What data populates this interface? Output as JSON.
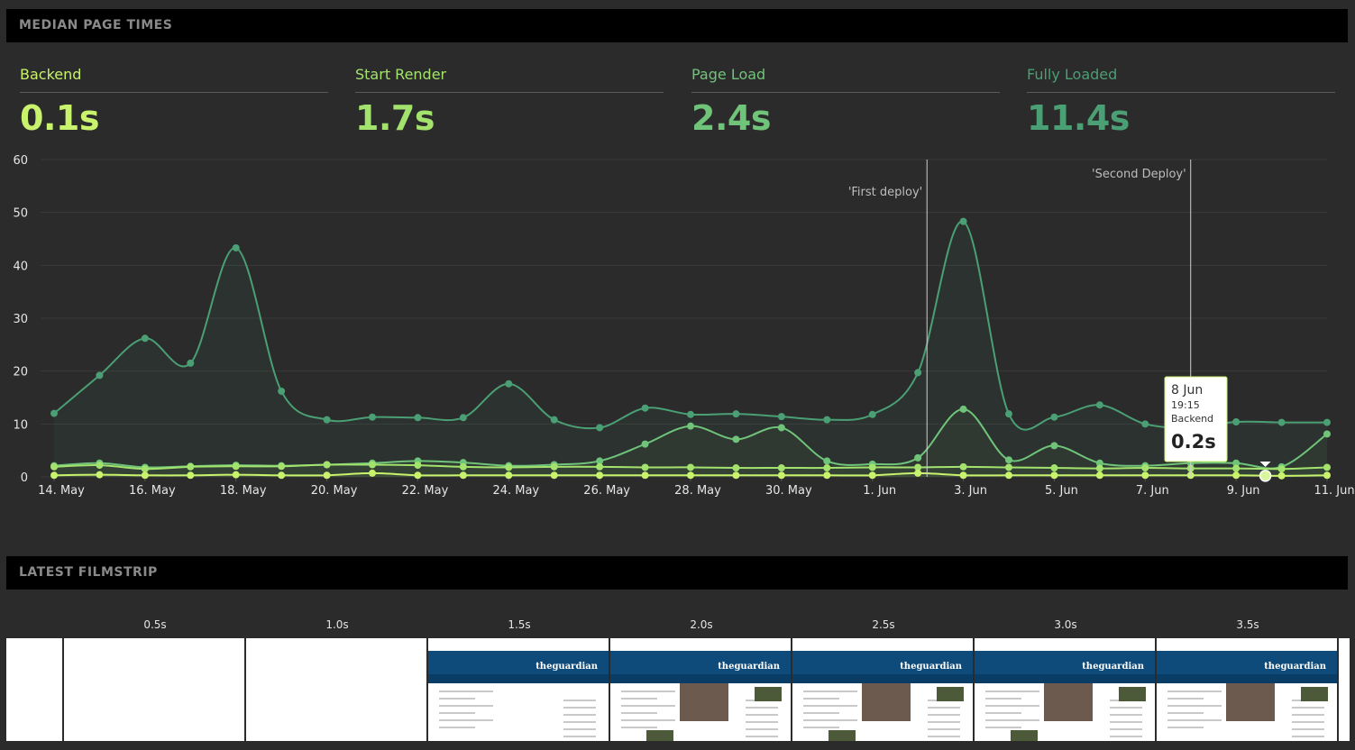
{
  "sections": {
    "median_title": "MEDIAN PAGE TIMES",
    "filmstrip_title": "LATEST FILMSTRIP"
  },
  "metrics": [
    {
      "label": "Backend",
      "value": "0.1s",
      "color": "#c9f26d"
    },
    {
      "label": "Start Render",
      "value": "1.7s",
      "color": "#a3e36d"
    },
    {
      "label": "Page Load",
      "value": "2.4s",
      "color": "#6fc47a"
    },
    {
      "label": "Fully Loaded",
      "value": "11.4s",
      "color": "#4a9f74"
    }
  ],
  "tooltip": {
    "date": "8 Jun",
    "time": "19:15",
    "series": "Backend",
    "value": "0.2s"
  },
  "filmstrip": {
    "times": [
      "0.5s",
      "1.0s",
      "1.5s",
      "2.0s",
      "2.5s",
      "3.0s",
      "3.5s"
    ],
    "logo_text": "theguardian"
  },
  "chart_data": {
    "type": "line",
    "ylim": [
      0,
      60
    ],
    "y_ticks": [
      0,
      10,
      20,
      30,
      40,
      50,
      60
    ],
    "x_tick_labels": [
      "14. May",
      "16. May",
      "18. May",
      "20. May",
      "22. May",
      "24. May",
      "26. May",
      "28. May",
      "30. May",
      "1. Jun",
      "3. Jun",
      "5. Jun",
      "7. Jun",
      "9. Jun",
      "11. Jun"
    ],
    "x_days": [
      0,
      0.5,
      1,
      1.5,
      2,
      2.5,
      3,
      3.5,
      4,
      4.5,
      5,
      5.5,
      6,
      6.5,
      7,
      7.5,
      8,
      8.5,
      9,
      9.5,
      10,
      10.5,
      11,
      11.5,
      12,
      12.5,
      13,
      13.5,
      14
    ],
    "annotations": [
      {
        "label": "'First deploy'",
        "x_day": 9.6
      },
      {
        "label": "'Second Deploy'",
        "x_day": 12.5
      }
    ],
    "series": [
      {
        "name": "Fully Loaded",
        "color": "#4a9f74",
        "values": [
          12,
          19.2,
          26.2,
          21.5,
          43.3,
          16.2,
          10.8,
          11.3,
          11.2,
          11.2,
          17.6,
          10.8,
          9.3,
          13,
          11.8,
          11.9,
          11.4,
          10.8,
          11.8,
          19.7,
          48.3,
          11.9,
          11.3,
          13.6,
          10,
          9.3,
          10.4,
          10.3,
          10.3
        ]
      },
      {
        "name": "Page Load",
        "color": "#6fc47a",
        "values": [
          2.1,
          2.6,
          1.8,
          2,
          2.2,
          2.1,
          2.3,
          2.6,
          3,
          2.7,
          2.1,
          2.3,
          3,
          6.2,
          9.6,
          7.1,
          9.3,
          3,
          2.4,
          3.6,
          12.8,
          3.2,
          5.9,
          2.6,
          2.1,
          2.6,
          2.6,
          1.9,
          8.1
        ]
      },
      {
        "name": "Start Render",
        "color": "#a3e36d",
        "values": [
          1.9,
          2.2,
          1.5,
          1.9,
          2,
          2,
          2.3,
          2.3,
          2.2,
          1.9,
          1.8,
          1.9,
          1.9,
          1.8,
          1.8,
          1.7,
          1.7,
          1.7,
          1.8,
          1.8,
          1.9,
          1.8,
          1.7,
          1.6,
          1.7,
          1.6,
          1.6,
          1.5,
          1.8
        ]
      },
      {
        "name": "Backend",
        "color": "#c9f26d",
        "values": [
          0.3,
          0.4,
          0.3,
          0.3,
          0.4,
          0.3,
          0.3,
          0.7,
          0.3,
          0.3,
          0.3,
          0.3,
          0.3,
          0.3,
          0.3,
          0.3,
          0.3,
          0.3,
          0.3,
          0.7,
          0.3,
          0.3,
          0.3,
          0.3,
          0.3,
          0.3,
          0.3,
          0.2,
          0.3
        ]
      }
    ]
  }
}
